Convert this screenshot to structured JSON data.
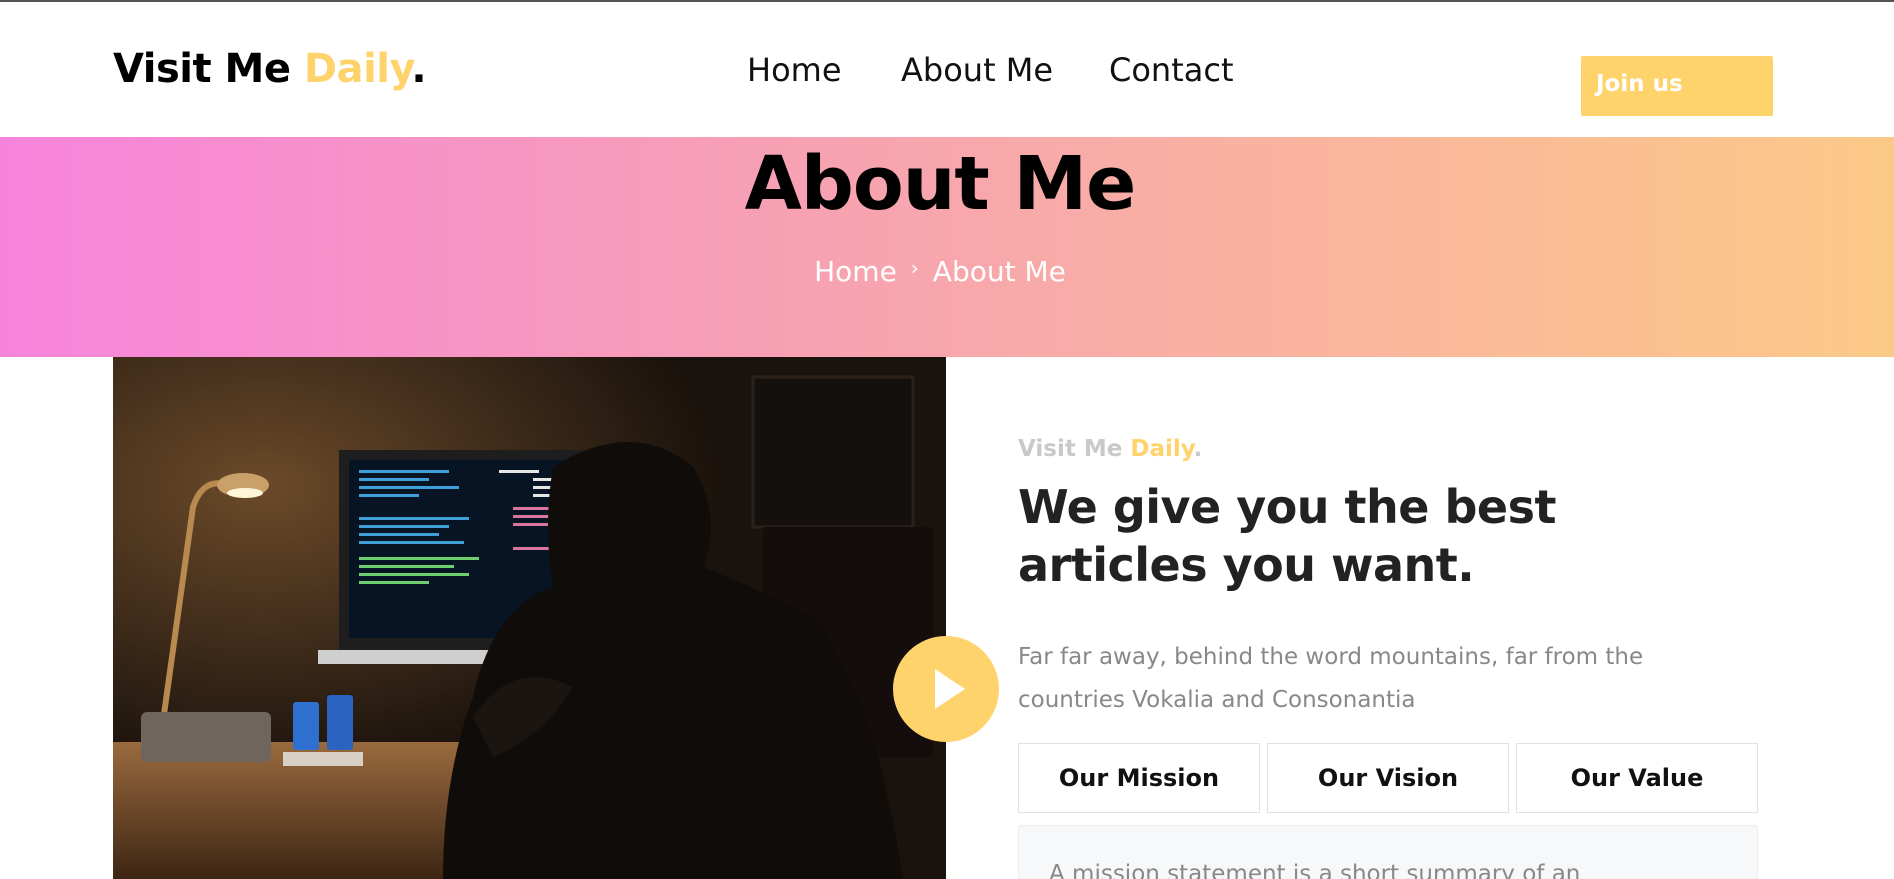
{
  "header": {
    "logo": {
      "main": "Visit Me ",
      "accent": "Daily",
      "dot": "."
    },
    "nav": [
      "Home",
      "About Me",
      "Contact"
    ],
    "join_label": "Join us"
  },
  "hero": {
    "title": "About Me",
    "breadcrumb": {
      "home": "Home",
      "separator": "›",
      "current": "About Me"
    }
  },
  "about": {
    "eyebrow": {
      "main": "Visit Me ",
      "accent": "Daily",
      "dot": "."
    },
    "heading": "We give you the best articles you want.",
    "description": "Far far away, behind the word mountains, far from the countries Vokalia and Consonantia",
    "tabs": [
      "Our Mission",
      "Our Vision",
      "Our Value"
    ],
    "panel_text": "A mission statement is a short summary of an"
  },
  "colors": {
    "accent": "#ffd36b",
    "hero_gradient_start": "#f784dc",
    "hero_gradient_end": "#fbc987"
  },
  "icons": {
    "play": "play-icon",
    "breadcrumb_separator": "chevron-right-icon"
  }
}
